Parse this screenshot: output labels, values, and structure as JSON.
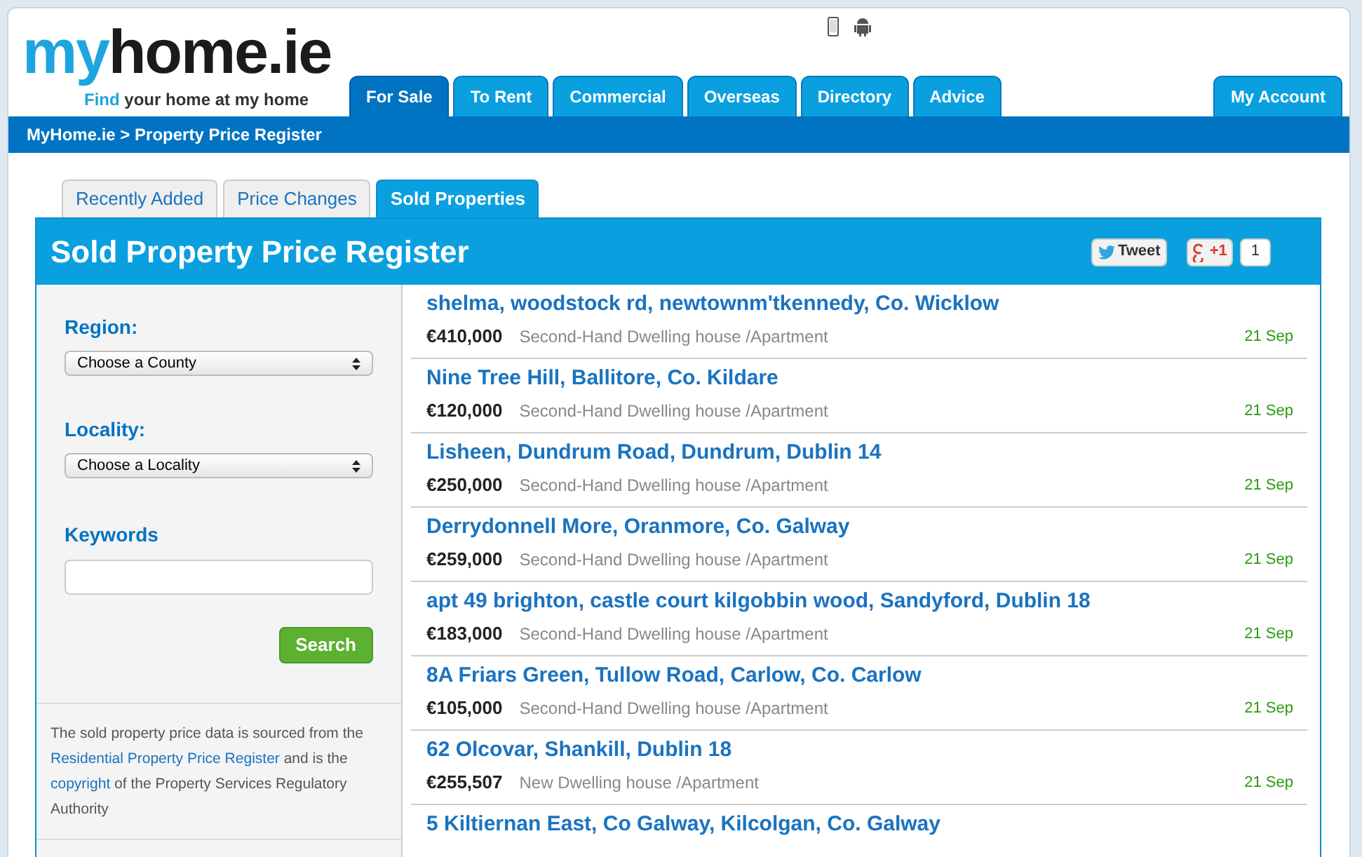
{
  "logo": {
    "prefix": "my",
    "name": "home.ie",
    "tagline_lead": "Find",
    "tagline": "your home at my home"
  },
  "nav_tabs": [
    {
      "label": "For Sale",
      "selected": true
    },
    {
      "label": "To Rent",
      "selected": false
    },
    {
      "label": "Commercial",
      "selected": false
    },
    {
      "label": "Overseas",
      "selected": false
    },
    {
      "label": "Directory",
      "selected": false
    },
    {
      "label": "Advice",
      "selected": false
    }
  ],
  "account_tab": {
    "label": "My Account"
  },
  "breadcrumb": "MyHome.ie > Property Price Register",
  "sub_tabs": [
    {
      "label": "Recently Added",
      "selected": false
    },
    {
      "label": "Price Changes",
      "selected": false
    },
    {
      "label": "Sold Properties",
      "selected": true
    }
  ],
  "panel": {
    "title": "Sold Property Price Register",
    "tweet": "Tweet",
    "plus_one": "+1",
    "plus_count": "1"
  },
  "filters": {
    "region_label": "Region:",
    "region_value": "Choose a County",
    "locality_label": "Locality:",
    "locality_value": "Choose a Locality",
    "keywords_label": "Keywords",
    "search_button": "Search"
  },
  "note": {
    "text_1": "The sold property price data is sourced from the",
    "link_1": "Residential Property Price Register",
    "text_2": "and is the",
    "link_2": "copyright",
    "text_3": "of the Property Services Regulatory Authority"
  },
  "listings": [
    {
      "address": "shelma, woodstock rd, newtownm'tkennedy, Co. Wicklow",
      "price": "€410,000",
      "type": "Second-Hand Dwelling house /Apartment",
      "date": "21 Sep"
    },
    {
      "address": "Nine Tree Hill, Ballitore, Co. Kildare",
      "price": "€120,000",
      "type": "Second-Hand Dwelling house /Apartment",
      "date": "21 Sep"
    },
    {
      "address": "Lisheen, Dundrum Road, Dundrum, Dublin 14",
      "price": "€250,000",
      "type": "Second-Hand Dwelling house /Apartment",
      "date": "21 Sep"
    },
    {
      "address": "Derrydonnell More, Oranmore, Co. Galway",
      "price": "€259,000",
      "type": "Second-Hand Dwelling house /Apartment",
      "date": "21 Sep"
    },
    {
      "address": "apt 49 brighton, castle court kilgobbin wood, Sandyford, Dublin 18",
      "price": "€183,000",
      "type": "Second-Hand Dwelling house /Apartment",
      "date": "21 Sep"
    },
    {
      "address": "8A Friars Green, Tullow Road, Carlow, Co. Carlow",
      "price": "€105,000",
      "type": "Second-Hand Dwelling house /Apartment",
      "date": "21 Sep"
    },
    {
      "address": "62 Olcovar, Shankill, Dublin 18",
      "price": "€255,507",
      "type": "New Dwelling house /Apartment",
      "date": "21 Sep"
    },
    {
      "address": "5 Kiltiernan East, Co Galway, Kilcolgan, Co. Galway"
    }
  ]
}
